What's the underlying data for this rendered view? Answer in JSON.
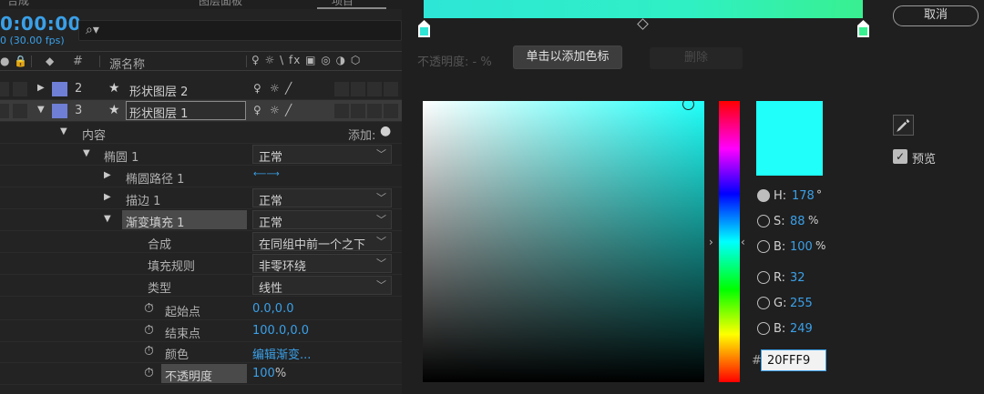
{
  "top_tabs": [
    "合成",
    "图层面板",
    "项目"
  ],
  "timecode": "0:00:00",
  "fps": "0 (30.00 fps)",
  "column_header": {
    "hash": "#",
    "source_name": "源名称",
    "switches": "♀ ☼ \\ fx ▣ ◎ ◑ ⬡"
  },
  "layers": [
    {
      "num": "2",
      "name": "形状图层 2"
    },
    {
      "num": "3",
      "name": "形状图层 1"
    }
  ],
  "properties": {
    "contents": "内容",
    "add": "添加:",
    "ellipse": "椭圆 1",
    "ellipse_mode": "正常",
    "ellipse_path": "椭圆路径 1",
    "stroke": "描边 1",
    "stroke_mode": "正常",
    "gradient_fill": "渐变填充 1",
    "gradient_fill_mode": "正常",
    "composite": "合成",
    "composite_value": "在同组中前一个之下",
    "fill_rule": "填充规则",
    "fill_rule_value": "非零环绕",
    "type": "类型",
    "type_value": "线性",
    "start_point": "起始点",
    "start_point_value": "0.0,0.0",
    "end_point": "结束点",
    "end_point_value": "100.0,0.0",
    "colors": "颜色",
    "colors_value": "编辑渐变...",
    "opacity": "不透明度",
    "opacity_value": "100",
    "opacity_unit": "%"
  },
  "gradient_editor": {
    "opacity_label": "不透明度: - %",
    "add_stop_button": "单击以添加色标",
    "delete_button": "删除",
    "cancel_button": "取消",
    "preview_label": "预览",
    "hex_value": "20FFF9",
    "current_color": "#20fff9",
    "hsb": {
      "h_label": "H:",
      "h_value": "178",
      "h_unit": "°",
      "s_label": "S:",
      "s_value": "88",
      "s_unit": "%",
      "b_label": "B:",
      "b_value": "100",
      "b_unit": "%"
    },
    "rgb": {
      "r_label": "R:",
      "r_value": "32",
      "g_label": "G:",
      "g_value": "255",
      "b_label": "B:",
      "b_value": "249"
    }
  },
  "colors": {
    "accent_blue": "#3aa0e8",
    "layer_label": "#6f7fd6"
  }
}
